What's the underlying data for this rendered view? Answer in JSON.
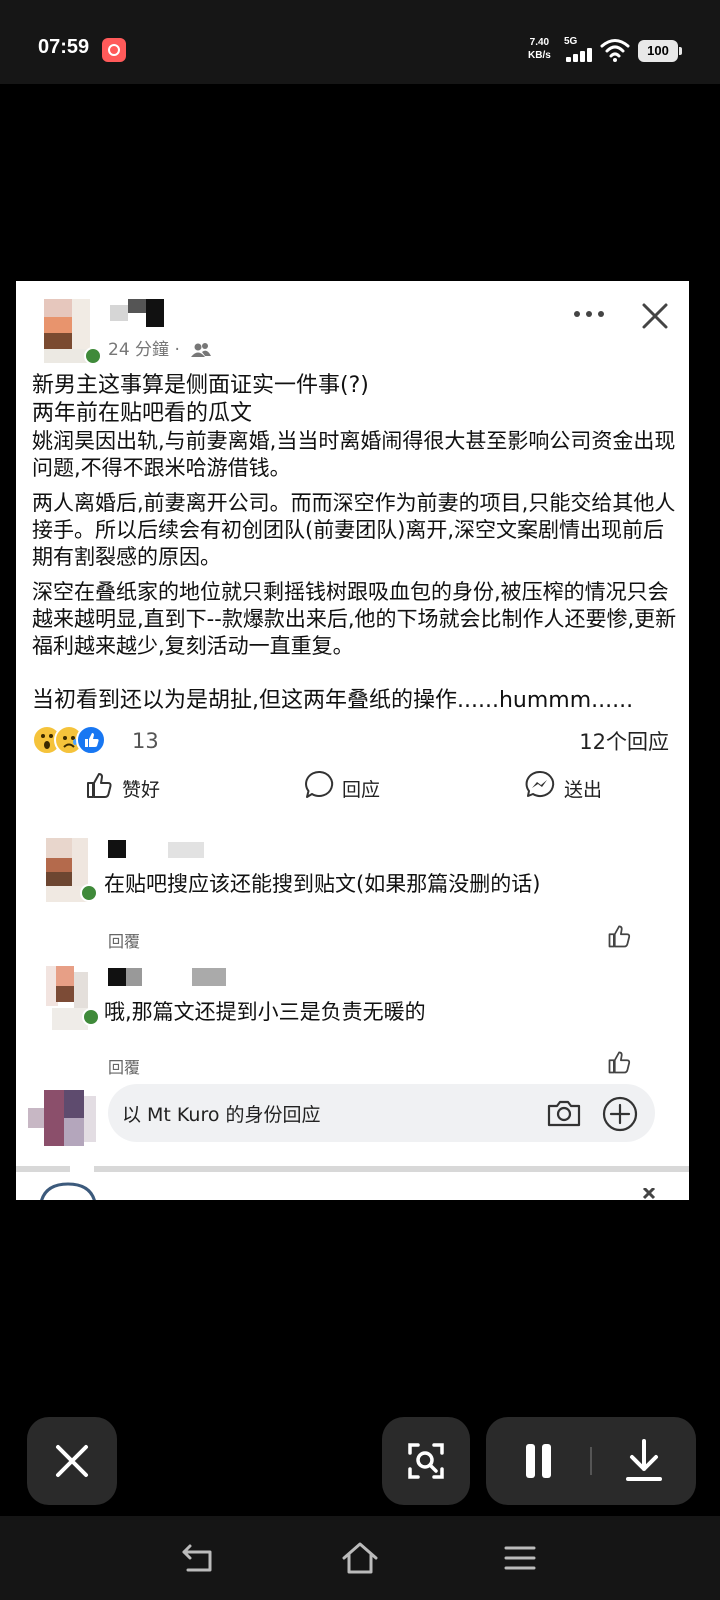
{
  "status_bar": {
    "time": "07:59",
    "net_speed_value": "7.40",
    "net_speed_unit": "KB/s",
    "network": "5G",
    "battery": "100"
  },
  "post": {
    "time_ago": "24 分鐘 ·",
    "lines": [
      "新男主这事算是侧面证实一件事(?)",
      "两年前在贴吧看的瓜文"
    ],
    "paragraphs": [
      "姚润昊因出轨,与前妻离婚,当当时离婚闹得很大甚至影响公司资金出现问题,不得不跟米哈游借钱。",
      "两人离婚后,前妻离开公司。而而深空作为前妻的项目,只能交给其他人接手。所以后续会有初创团队(前妻团队)离开,深空文案剧情出现前后期有割裂感的原因。",
      "深空在叠纸家的地位就只剩摇钱树跟吸血包的身份,被压榨的情况只会越来越明显,直到下--款爆款出来后,他的下场就会比制作人还要惨,更新福利越来越少,复刻活动一直重复。"
    ],
    "closing": "当初看到还以为是胡扯,但这两年叠纸的操作......hummm......",
    "reaction_count": "13",
    "reply_count": "12个回应"
  },
  "actions": {
    "like": "赞好",
    "comment": "回应",
    "share": "送出"
  },
  "comments": [
    {
      "text": "在贴吧搜应该还能搜到贴文(如果那篇没删的话)",
      "reply_label": "回覆"
    },
    {
      "text": "哦,那篇文还提到小三是负责无暖的",
      "reply_label": "回覆"
    }
  ],
  "composer": {
    "placeholder": "以 Mt Kuro 的身份回应"
  }
}
